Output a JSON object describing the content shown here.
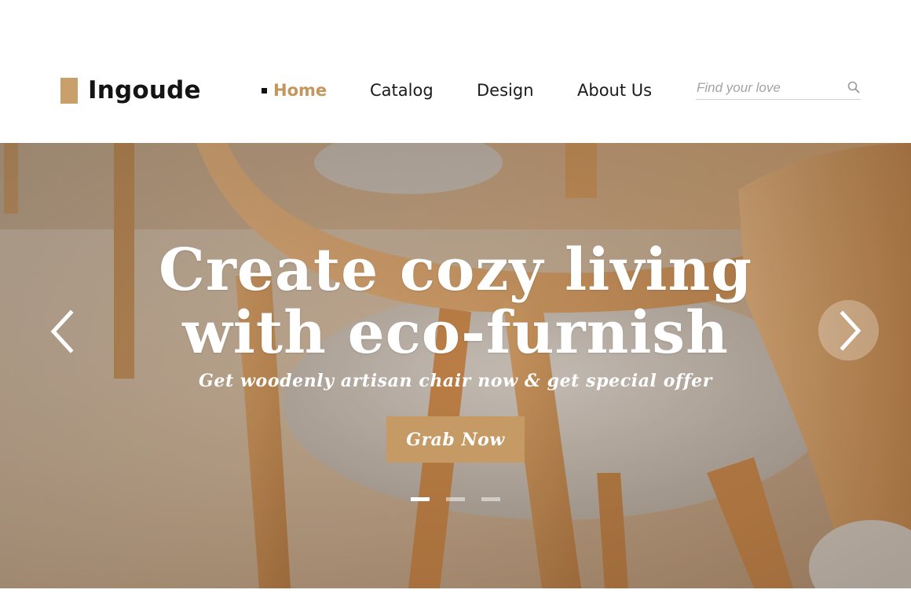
{
  "brand": {
    "name": "Ingoude",
    "accent": "#c99f6c"
  },
  "nav": {
    "items": [
      {
        "label": "Home",
        "active": true
      },
      {
        "label": "Catalog",
        "active": false
      },
      {
        "label": "Design",
        "active": false
      },
      {
        "label": "About Us",
        "active": false
      }
    ]
  },
  "search": {
    "placeholder": "Find your love",
    "value": "",
    "icon": "search-icon"
  },
  "hero": {
    "title_line1": "Create cozy living",
    "title_line2": "with eco-furnish",
    "subtitle": "Get woodenly artisan chair now & get special offer",
    "cta_label": "Grab Now",
    "cta_color": "#c69a65",
    "prev_icon": "chevron-left-icon",
    "next_icon": "chevron-right-icon",
    "slides": {
      "count": 3,
      "active_index": 0
    }
  }
}
